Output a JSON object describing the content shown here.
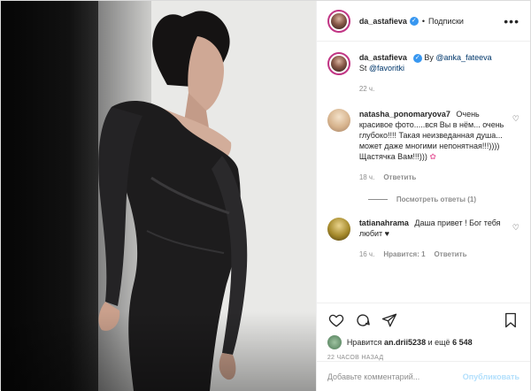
{
  "post": {
    "author": {
      "username": "da_astafieva",
      "verified_icon": "verified-badge-icon",
      "follow_status": "Подписки",
      "separator": "•"
    },
    "caption": {
      "username": "da_astafieva",
      "by_text": "By",
      "by_link": "@anka_fateeva",
      "st_text": "St",
      "st_link": "@favoritki",
      "time": "22 ч."
    },
    "comments": [
      {
        "username": "natasha_ponomaryova7",
        "text": "Очень красивое фото.....вся Вы в нём... очень глубоко!!!! Такая неизведанная душа... может даже многими непонятная!!!)))) Щастячка Вам!!!)))",
        "emoji": "✿",
        "time": "18 ч.",
        "reply_label": "Ответить",
        "view_replies": "Посмотреть ответы (1)"
      },
      {
        "username": "tatianahrama",
        "text": "Даша привет ! Бог тебя любит",
        "emoji": "♥",
        "time": "16 ч.",
        "likes": "Нравится: 1",
        "reply_label": "Ответить"
      }
    ],
    "likes": {
      "prefix": "Нравится",
      "user": "an.drii5238",
      "suffix": "и ещё",
      "count": "6 548"
    },
    "time_ago": "22 ЧАСОВ НАЗАД",
    "add_comment": {
      "placeholder": "Добавьте комментарий...",
      "publish_label": "Опубликовать"
    }
  }
}
